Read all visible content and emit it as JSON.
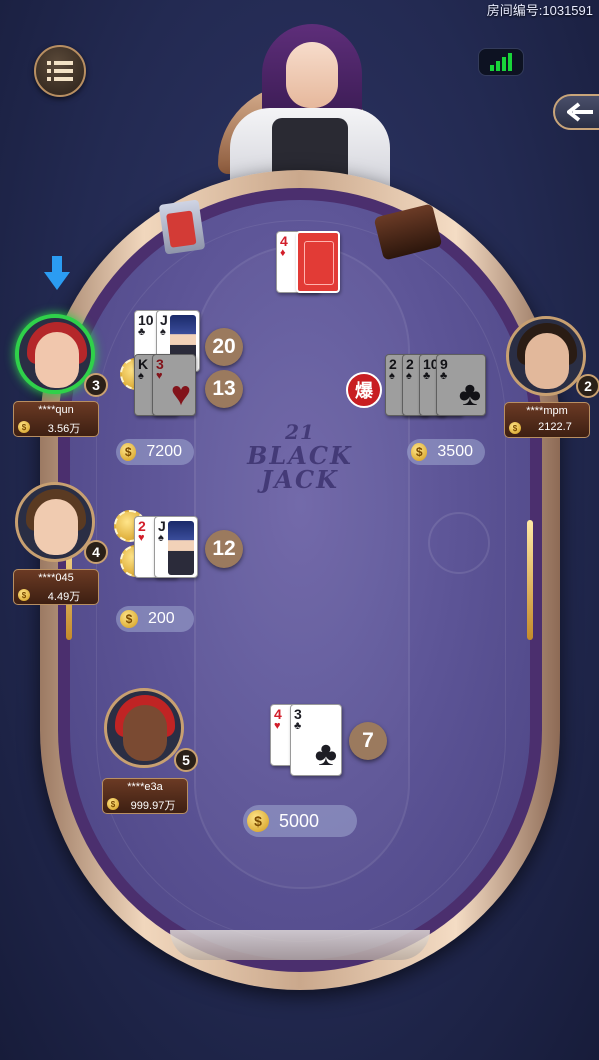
{
  "header": {
    "room_id": "房间编号:1031591",
    "menu_icon": "list-icon",
    "signal_icon": "signal-strength-icon",
    "back_icon": "back-arrow-icon"
  },
  "table": {
    "logo_number": "21",
    "logo_line1": "BLACK",
    "logo_line2": "JACK"
  },
  "dealer": {
    "upcard": {
      "rank": "4",
      "suit": "♦",
      "color": "red"
    }
  },
  "seats": [
    {
      "seat_number": "3",
      "name": "****qun",
      "balance": "3.56万",
      "active": true,
      "hands": [
        {
          "cards": [
            {
              "rank": "10",
              "suit": "♣",
              "color": "black"
            },
            {
              "rank": "J",
              "suit": "♠",
              "color": "black"
            }
          ],
          "score": "20"
        },
        {
          "cards": [
            {
              "rank": "K",
              "suit": "♠",
              "color": "black"
            },
            {
              "rank": "3",
              "suit": "♥",
              "color": "red"
            }
          ],
          "score": "13"
        }
      ],
      "bet": "7200"
    },
    {
      "seat_number": "2",
      "name": "****mpm",
      "balance": "2122.7",
      "active": false,
      "hands": [
        {
          "cards": [
            {
              "rank": "2",
              "suit": "♠",
              "color": "black"
            },
            {
              "rank": "2",
              "suit": "♠",
              "color": "black"
            },
            {
              "rank": "10",
              "suit": "♣",
              "color": "black"
            },
            {
              "rank": "9",
              "suit": "♣",
              "color": "black"
            }
          ],
          "bust": "爆"
        }
      ],
      "bet": "3500"
    },
    {
      "seat_number": "4",
      "name": "****045",
      "balance": "4.49万",
      "active": false,
      "hands": [
        {
          "cards": [
            {
              "rank": "2",
              "suit": "♥",
              "color": "red"
            },
            {
              "rank": "J",
              "suit": "♠",
              "color": "black"
            }
          ],
          "score": "12"
        }
      ],
      "bet": "200"
    },
    {
      "seat_number": "5",
      "name": "****e3a",
      "balance": "999.97万",
      "active": false
    },
    {
      "seat_number": "self",
      "hands": [
        {
          "cards": [
            {
              "rank": "4",
              "suit": "♥",
              "color": "red"
            },
            {
              "rank": "3",
              "suit": "♣",
              "color": "black"
            }
          ],
          "score": "7"
        }
      ],
      "bet": "5000"
    }
  ],
  "coin_symbol": "$",
  "turn_indicator_icon": "down-arrow-icon",
  "colors": {
    "felt": "#5c5496",
    "active_ring": "#2fd14a",
    "score_bubble": "#9b7a5e",
    "bust_badge": "#c81e22"
  }
}
